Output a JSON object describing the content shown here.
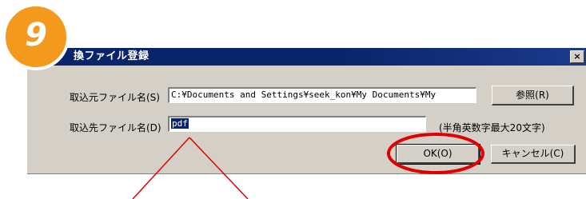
{
  "step_badge": {
    "number": "9",
    "color": "#f39a1e"
  },
  "dialog": {
    "title": "換ファイル登録",
    "close_label": "×"
  },
  "source": {
    "label": "取込元ファイル名(S)",
    "value": "C:¥Documents and Settings¥seek_kon¥My Documents¥My",
    "browse_label": "参照(R)"
  },
  "destination": {
    "label": "取込先ファイル名(D)",
    "value": "pdf",
    "hint": "(半角英数字最大20文字)"
  },
  "buttons": {
    "ok_label": "OK(O)",
    "cancel_label": "キャンセル(C)"
  },
  "annotations": {
    "highlight_color": "#e00000",
    "callout_color": "#e00000"
  }
}
